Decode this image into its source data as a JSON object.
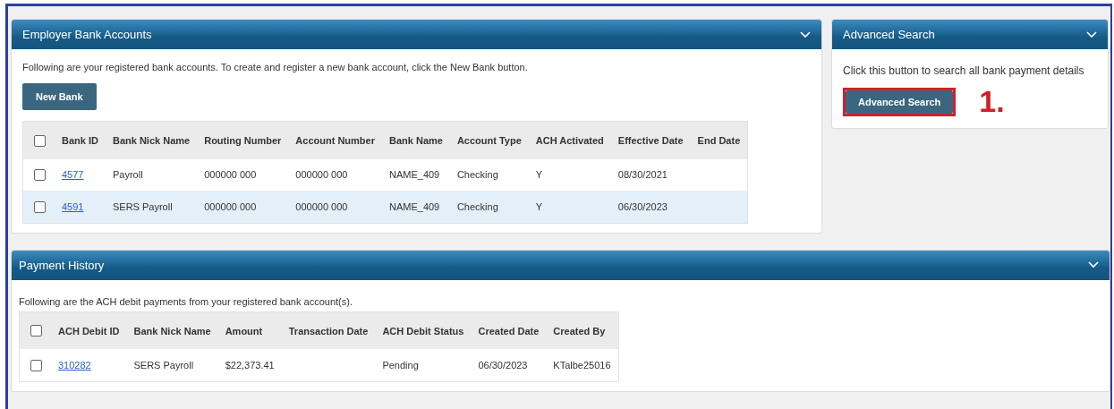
{
  "bank_panel": {
    "title": "Employer Bank Accounts",
    "intro": "Following are your registered bank accounts. To create and register a new bank account, click the New Bank button.",
    "new_button": "New Bank",
    "table": {
      "select_all_checked": false,
      "columns": [
        "Bank ID",
        "Bank Nick Name",
        "Routing Number",
        "Account Number",
        "Bank Name",
        "Account Type",
        "ACH Activated",
        "Effective Date",
        "End Date"
      ],
      "rows": [
        {
          "checked": false,
          "cells": [
            "4577",
            "Payroll",
            "000000 000",
            "000000 000",
            "NAME_409",
            "Checking",
            "Y",
            "08/30/2021",
            ""
          ]
        },
        {
          "checked": false,
          "cells": [
            "4591",
            "SERS Payroll",
            "000000 000",
            "000000 000",
            "NAME_409",
            "Checking",
            "Y",
            "06/30/2023",
            ""
          ]
        }
      ]
    }
  },
  "search_panel": {
    "title": "Advanced Search",
    "text": "Click this button to search all bank payment details",
    "button": "Advanced Search",
    "highlighted": true,
    "annotation": "1."
  },
  "payment_panel": {
    "title": "Payment History",
    "intro": "Following are the ACH debit payments from your registered bank account(s).",
    "table": {
      "select_all_checked": false,
      "columns": [
        "ACH Debit ID",
        "Bank Nick Name",
        "Amount",
        "Transaction Date",
        "ACH Debit Status",
        "Created Date",
        "Created By"
      ],
      "rows": [
        {
          "checked": false,
          "cells": [
            "310282",
            "SERS Payroll",
            "$22,373.41",
            "",
            "Pending",
            "06/30/2023",
            "KTalbe25016"
          ]
        }
      ]
    }
  }
}
